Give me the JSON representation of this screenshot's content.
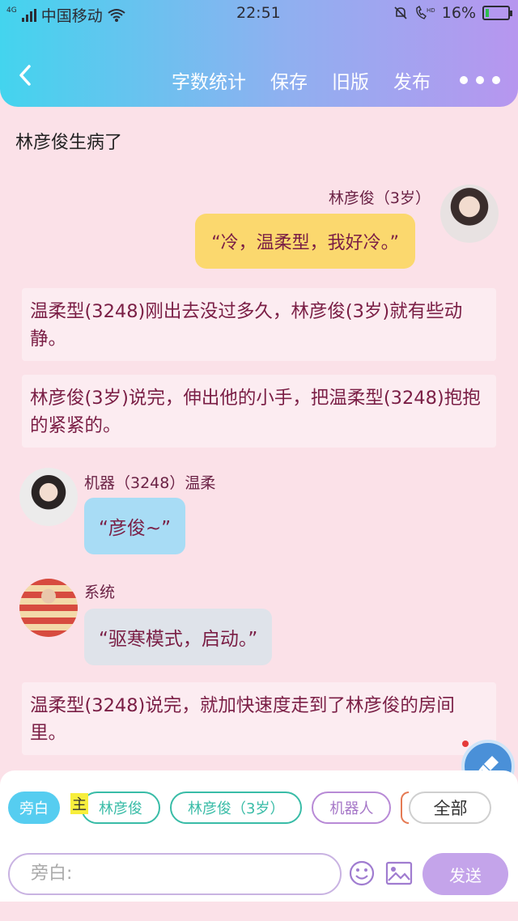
{
  "statusbar": {
    "carrier": "中国移动",
    "network": "4G",
    "time": "22:51",
    "battery": "16%",
    "battery_fraction": 0.16
  },
  "nav": {
    "back_icon": "chevron-left-icon",
    "actions": [
      "字数统计",
      "保存",
      "旧版",
      "发布"
    ],
    "more_icon": "more-dots-icon"
  },
  "story_title": "林彦俊生病了",
  "messages": {
    "m1": {
      "name": "林彦俊（3岁）",
      "text": "“冷，温柔型，我好冷。”"
    },
    "n1": {
      "text": "温柔型(3248)刚出去没过多久，林彦俊(3岁)就有些动静。"
    },
    "n2": {
      "text": "林彦俊(3岁)说完，伸出他的小手，把温柔型(3248)抱抱的紧紧的。"
    },
    "m2": {
      "name": "机器（3248）温柔",
      "text": "“彦俊~”"
    },
    "m3": {
      "name": "系统",
      "text": "“驱寒模式，启动。”"
    },
    "n3": {
      "text": "温柔型(3248)说完，就加快速度走到了林彦俊的房间里。"
    }
  },
  "roles": {
    "items": [
      "旁白",
      "林彦俊",
      "林彦俊（3岁）",
      "机器人",
      "全部"
    ],
    "main_tag": "主"
  },
  "composer": {
    "placeholder": "旁白:",
    "send_label": "发送"
  },
  "colors": {
    "header_start": "#43d4ee",
    "header_end": "#b796ef",
    "background": "#fbe1e8",
    "accent_text": "#7a1e45"
  }
}
